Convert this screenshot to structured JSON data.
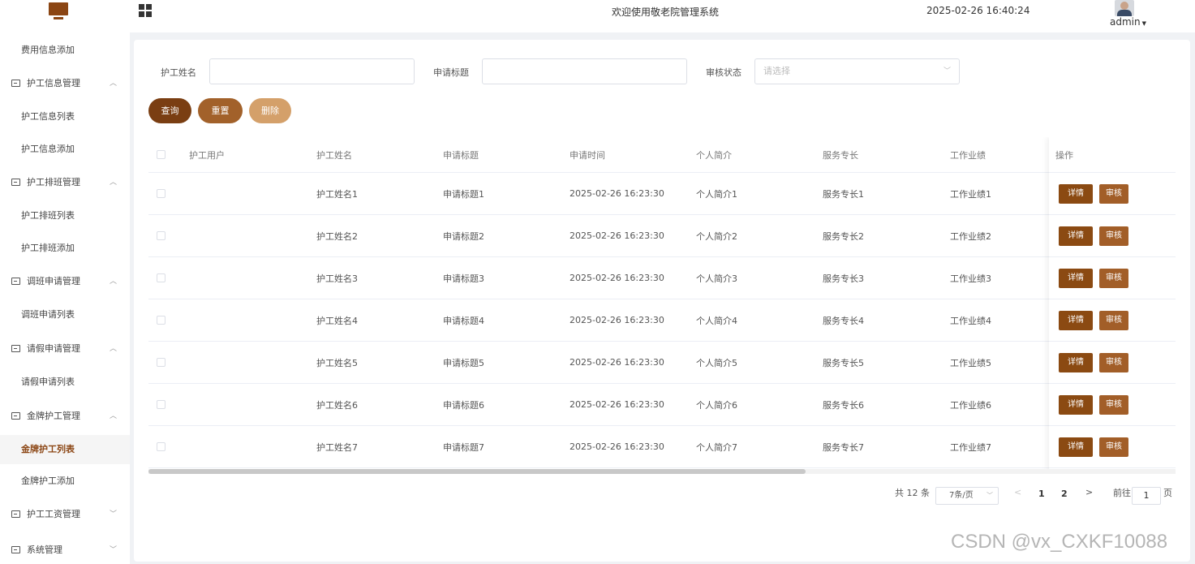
{
  "header": {
    "title": "欢迎使用敬老院管理系统",
    "datetime": "2025-02-26 16:40:24",
    "user": "admin",
    "logo_icon": "monitor-icon",
    "menu_icon": "grid-icon"
  },
  "sidebar": {
    "items": [
      {
        "label": "费用信息添加",
        "type": "sub"
      },
      {
        "label": "护工信息管理",
        "type": "group",
        "arrow": "^"
      },
      {
        "label": "护工信息列表",
        "type": "sub"
      },
      {
        "label": "护工信息添加",
        "type": "sub"
      },
      {
        "label": "护工排班管理",
        "type": "group",
        "arrow": "^"
      },
      {
        "label": "护工排班列表",
        "type": "sub"
      },
      {
        "label": "护工排班添加",
        "type": "sub"
      },
      {
        "label": "调班申请管理",
        "type": "group",
        "arrow": "^"
      },
      {
        "label": "调班申请列表",
        "type": "sub"
      },
      {
        "label": "请假申请管理",
        "type": "group",
        "arrow": "^"
      },
      {
        "label": "请假申请列表",
        "type": "sub"
      },
      {
        "label": "金牌护工管理",
        "type": "group",
        "arrow": "^"
      },
      {
        "label": "金牌护工列表",
        "type": "sub",
        "active": true
      },
      {
        "label": "金牌护工添加",
        "type": "sub"
      },
      {
        "label": "护工工资管理",
        "type": "group",
        "arrow": "v"
      },
      {
        "label": "系统管理",
        "type": "group",
        "arrow": "v"
      }
    ]
  },
  "filters": {
    "nurse_name_label": "护工姓名",
    "nurse_name_value": "",
    "apply_title_label": "申请标题",
    "apply_title_value": "",
    "status_label": "审核状态",
    "status_placeholder": "请选择"
  },
  "buttons": {
    "query": "查询",
    "reset": "重置",
    "delete": "删除"
  },
  "table": {
    "columns": [
      "护工用户",
      "护工姓名",
      "申请标题",
      "申请时间",
      "个人简介",
      "服务专长",
      "工作业绩",
      "操作"
    ],
    "rows": [
      {
        "user": "",
        "name": "护工姓名1",
        "title": "申请标题1",
        "time": "2025-02-26 16:23:30",
        "intro": "个人简介1",
        "skill": "服务专长1",
        "perf": "工作业绩1"
      },
      {
        "user": "",
        "name": "护工姓名2",
        "title": "申请标题2",
        "time": "2025-02-26 16:23:30",
        "intro": "个人简介2",
        "skill": "服务专长2",
        "perf": "工作业绩2"
      },
      {
        "user": "",
        "name": "护工姓名3",
        "title": "申请标题3",
        "time": "2025-02-26 16:23:30",
        "intro": "个人简介3",
        "skill": "服务专长3",
        "perf": "工作业绩3"
      },
      {
        "user": "",
        "name": "护工姓名4",
        "title": "申请标题4",
        "time": "2025-02-26 16:23:30",
        "intro": "个人简介4",
        "skill": "服务专长4",
        "perf": "工作业绩4"
      },
      {
        "user": "",
        "name": "护工姓名5",
        "title": "申请标题5",
        "time": "2025-02-26 16:23:30",
        "intro": "个人简介5",
        "skill": "服务专长5",
        "perf": "工作业绩5"
      },
      {
        "user": "",
        "name": "护工姓名6",
        "title": "申请标题6",
        "time": "2025-02-26 16:23:30",
        "intro": "个人简介6",
        "skill": "服务专长6",
        "perf": "工作业绩6"
      },
      {
        "user": "",
        "name": "护工姓名7",
        "title": "申请标题7",
        "time": "2025-02-26 16:23:30",
        "intro": "个人简介7",
        "skill": "服务专长7",
        "perf": "工作业绩7"
      }
    ],
    "actions": {
      "detail": "详情",
      "audit": "审核"
    }
  },
  "pagination": {
    "total": "共 12 条",
    "page_size": "7条/页",
    "pages": [
      "1",
      "2"
    ],
    "prev": "<",
    "next": ">",
    "goto_label": "前往",
    "goto_value": "1",
    "goto_suffix": "页"
  },
  "watermark": "CSDN @vx_CXKF10088",
  "colors": {
    "brand": "#8b4513",
    "query_button": "#7a3e12",
    "reset_button": "#a2612a",
    "delete_button": "#d4a06a",
    "detail_button": "#8b4a12",
    "audit_button": "#a25e28"
  }
}
